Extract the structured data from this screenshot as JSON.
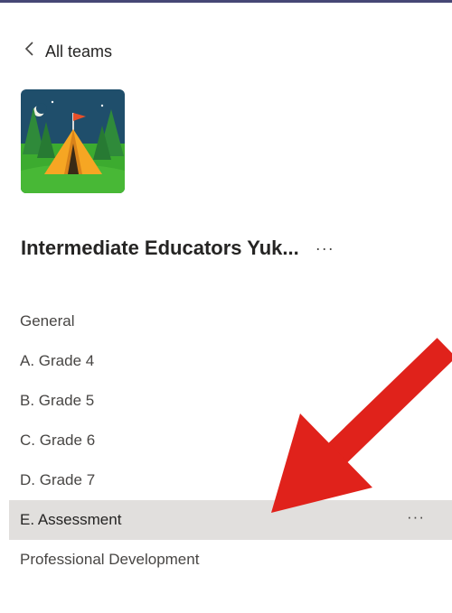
{
  "nav": {
    "back_label": "All teams"
  },
  "team": {
    "name": "Intermediate Educators Yuk...",
    "more": "···"
  },
  "channels": [
    {
      "label": "General"
    },
    {
      "label": "A. Grade 4"
    },
    {
      "label": "B. Grade 5"
    },
    {
      "label": "C. Grade 6"
    },
    {
      "label": "D. Grade 7"
    },
    {
      "label": "E. Assessment",
      "more": "···"
    },
    {
      "label": "Professional Development"
    }
  ],
  "colors": {
    "top_border": "#464775",
    "selected_row": "#e1dfdd",
    "annotation_arrow": "#e0221b",
    "avatar_sky": "#1f4e6b",
    "avatar_grass": "#3cab2f",
    "tent": "#f6a623"
  }
}
